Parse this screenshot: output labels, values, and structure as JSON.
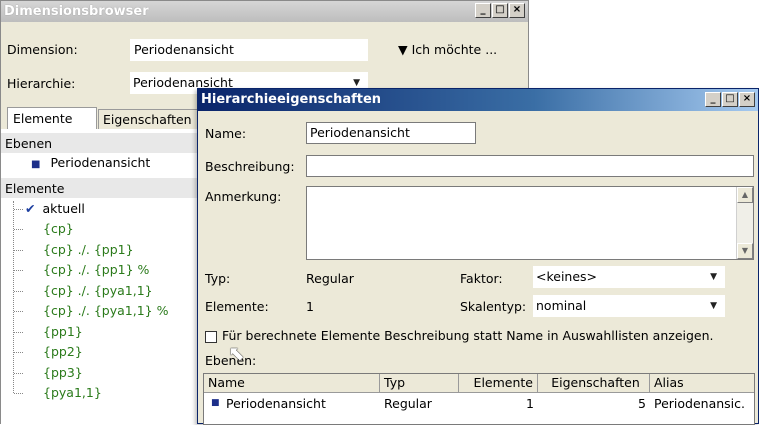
{
  "back_window": {
    "title": "Dimensionsbrowser",
    "dimension_label": "Dimension:",
    "dimension_value": "Periodenansicht",
    "action_label": "▼ Ich möchte ...",
    "hierarchy_label": "Hierarchie:",
    "hierarchy_value": "Periodenansicht",
    "tabs": [
      "Elemente",
      "Eigenschaften"
    ],
    "levels_header": "Ebenen",
    "level_item": "Periodenansicht",
    "elements_header": "Elemente",
    "tree_items": [
      "aktuell",
      "{cp}",
      "{cp} ./. {pp1}",
      "{cp} ./. {pp1} %",
      "{cp} ./. {pya1,1}",
      "{cp} ./. {pya1,1} %",
      "{pp1}",
      "{pp2}",
      "{pp3}",
      "{pya1,1}"
    ]
  },
  "dialog": {
    "title": "Hierarchieeigenschaften",
    "name_label": "Name:",
    "name_value": "Periodenansicht",
    "description_label": "Beschreibung:",
    "description_value": "",
    "note_label": "Anmerkung:",
    "note_value": "",
    "type_label": "Typ:",
    "type_value": "Regular",
    "factor_label": "Faktor:",
    "factor_value": "<keines>",
    "elements_label": "Elemente:",
    "elements_value": "1",
    "scale_label": "Skalentyp:",
    "scale_value": "nominal",
    "checkbox_label": "Für berechnete Elemente Beschreibung statt Name in Auswahllisten anzeigen.",
    "levels_label": "Ebenen:",
    "table": {
      "columns": [
        "Name",
        "Typ",
        "Elemente",
        "Eigenschaften",
        "Alias"
      ],
      "rows": [
        {
          "name": "Periodenansicht",
          "typ": "Regular",
          "elemente": "1",
          "eigenschaften": "5",
          "alias": "Periodenansic."
        }
      ]
    }
  },
  "colors": {
    "back_titlebar": "#c9c9c9",
    "dialog_titlebar": "#0a246a",
    "tree_text": "#2a7a1a",
    "window_bg": "#ece9d8"
  }
}
